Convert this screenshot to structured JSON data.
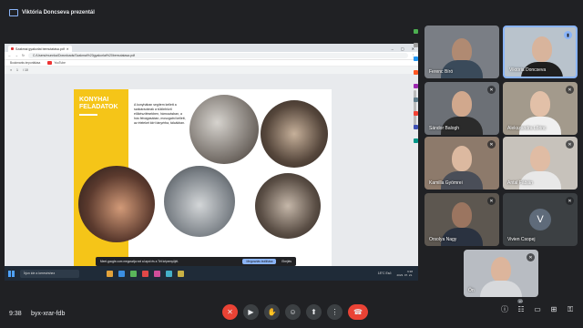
{
  "top": {
    "title": "Viktória Doncseva prezentál"
  },
  "browser": {
    "tab_title": "Szakmai gyakorlat bemutatása.pdf",
    "url": "C:/Users/munnka/Downloads/Szakmai%20gyakorlat%20bemutatasa.pdf",
    "bookmarks": [
      "Bookmarks importálása",
      "YouTube"
    ],
    "pdf_page": "1",
    "pdf_pages_total": "/ 10"
  },
  "slide": {
    "heading": "KONYHAI FELADATOK",
    "body": "A konyhában segítem kellett a szakácsoknak a különböző előkészítésekben, hámozásban, a hús felvágásában, mosogatni kellett, az ételeket kiírt tányérba, tálcákban."
  },
  "notification": {
    "text": "Meet.google.com megosztja ezt a lapot és a Tét képernyőjét.",
    "stop_label": "Megosztás leállítása",
    "hide_label": "Elrejtés"
  },
  "taskbar": {
    "search_placeholder": "Írjon ide a kereséshez",
    "weather": "18°C Eső",
    "time": "9:38",
    "date": "2023. 07. 21."
  },
  "participants": [
    {
      "name": "Ferenc Bíró",
      "muted": false
    },
    {
      "name": "Viktória Doncseva",
      "muted": false,
      "active": true
    },
    {
      "name": "Sándor Balogh",
      "muted": true
    },
    {
      "name": "Alekszandra Lőrinc",
      "muted": true
    },
    {
      "name": "Kamilla Gyömrei",
      "muted": true
    },
    {
      "name": "Antal Fábián",
      "muted": true
    },
    {
      "name": "Orsolya Nagy",
      "muted": true
    },
    {
      "name": "Vivien Csopej",
      "muted": true,
      "initial": "V"
    },
    {
      "name": "Ön",
      "muted": true
    }
  ],
  "bottom": {
    "time": "9:38",
    "meeting_code": "byx-xrar-fdb",
    "participants_count": "10"
  },
  "colors": {
    "accent": "#8ab4f8",
    "danger": "#ea4335",
    "slide_yellow": "#f5c518",
    "bg": "#202124"
  }
}
